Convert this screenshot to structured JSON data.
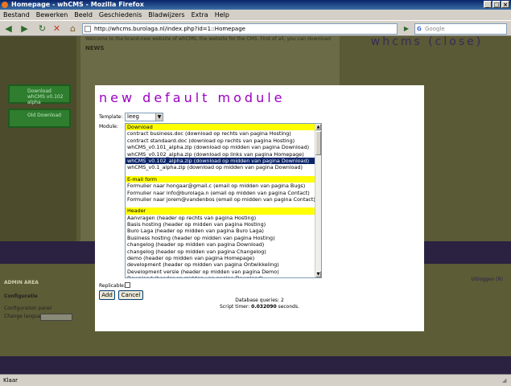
{
  "window": {
    "title": "Homepage - whCMS - Mozilla Firefox",
    "min_glyph": "_",
    "max_glyph": "□",
    "close_glyph": "×"
  },
  "menu": [
    "Bestand",
    "Bewerken",
    "Beeld",
    "Geschiedenis",
    "Bladwijzers",
    "Extra",
    "Help"
  ],
  "nav": {
    "url": "http://whcms.burolaga.nl/index.php?id=1::Homepage",
    "search_engine_letter": "G",
    "search_placeholder": "Google",
    "back_glyph": "◀",
    "forward_glyph": "▶",
    "reload_glyph": "↻",
    "stop_glyph": "✕",
    "home_glyph": "⌂",
    "go_glyph": "▶"
  },
  "page": {
    "news_heading": "NEWS",
    "welcome_text": "Welcome to the brand-new website of whCMS, the website for the CMS. First of all, you can download",
    "logo_left": "whcms",
    "logo_right": "(close)",
    "download_box_1": "Download whCMS v0.102 alpha",
    "download_box_2": "Old Download",
    "admin_area_label": "ADMIN AREA",
    "admin_sub_label": "Configuratie",
    "admin_row_1": "Configuration panel",
    "admin_row_2": "Change language:",
    "right_link": "Uitloggen (R)"
  },
  "modal": {
    "title": "new default module",
    "template_label": "Template:",
    "template_value": "leeg",
    "module_label": "Module:",
    "options": [
      {
        "text": "Download",
        "kind": "group"
      },
      {
        "text": "contract business.doc (download op rechts van pagina Hosting)",
        "kind": "item"
      },
      {
        "text": "contract standaard.doc (download op rechts van pagina Hosting)",
        "kind": "item"
      },
      {
        "text": "whCMS_v0.101_alpha.zip (download op midden van pagina Download)",
        "kind": "item"
      },
      {
        "text": "whCMS_v0.102_alpha.zip (download op links van pagina Homepage)",
        "kind": "item"
      },
      {
        "text": "whCMS_v0.102_alpha.zip (download op midden van pagina Download)",
        "kind": "selected"
      },
      {
        "text": "whCMS_v0.1_alpha.zip (download op midden van pagina Download)",
        "kind": "item"
      },
      {
        "text": "",
        "kind": "blank"
      },
      {
        "text": "E-mail form",
        "kind": "group"
      },
      {
        "text": "Formulier naar hongaar@gmail.c (email op midden van pagina Bugs)",
        "kind": "item"
      },
      {
        "text": "Formulier naar info@burolaga.n (email op midden van pagina Contact)",
        "kind": "item"
      },
      {
        "text": "Formulier naar jorem@vandenbos (email op midden van pagina Contact)",
        "kind": "item"
      },
      {
        "text": "",
        "kind": "blank"
      },
      {
        "text": "Header",
        "kind": "group"
      },
      {
        "text": "Aanvragen (header op rechts van pagina Hosting)",
        "kind": "item"
      },
      {
        "text": "Basis hosting (header op midden van pagina Hosting)",
        "kind": "item"
      },
      {
        "text": "Buro Laga (header op midden van pagina Buro Laga)",
        "kind": "item"
      },
      {
        "text": "Business hosting (header op midden van pagina Hosting)",
        "kind": "item"
      },
      {
        "text": "changelog (header op midden van pagina Download)",
        "kind": "item"
      },
      {
        "text": "changelog (header op midden van pagina Changelog)",
        "kind": "item"
      },
      {
        "text": "demo (header op midden van pagina Homepage)",
        "kind": "item"
      },
      {
        "text": "development (header op midden van pagina Ontwikkeling)",
        "kind": "item"
      },
      {
        "text": "Development versie (header op midden van pagina Demo)",
        "kind": "item"
      },
      {
        "text": "Download (header op midden van pagina Download)",
        "kind": "item"
      }
    ],
    "replicable_label": "Replicable:",
    "add_label": "Add",
    "cancel_label": "Cancel",
    "db_queries": "Database queries: 2",
    "script_timer_prefix": "Script timer: ",
    "script_timer_value": "0.032090",
    "script_timer_suffix": " seconds."
  },
  "status": {
    "text": "Klaar"
  }
}
